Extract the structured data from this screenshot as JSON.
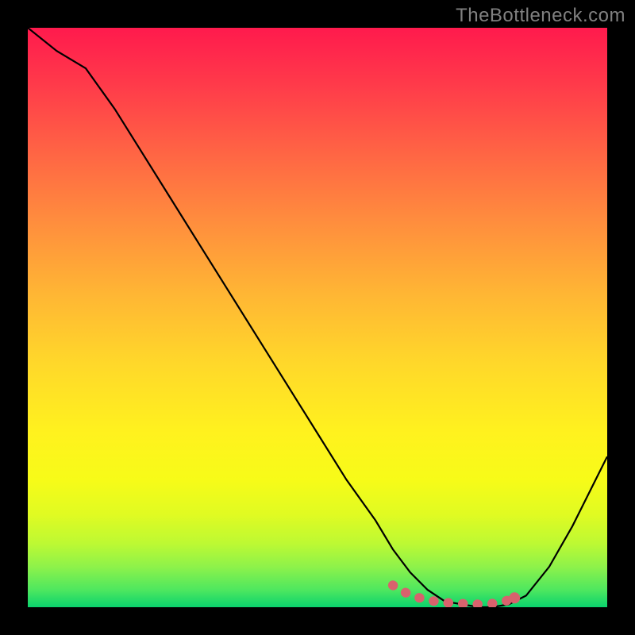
{
  "watermark": "TheBottleneck.com",
  "chart_data": {
    "type": "line",
    "title": "",
    "xlabel": "",
    "ylabel": "",
    "xlim": [
      0,
      100
    ],
    "ylim": [
      0,
      100
    ],
    "series": [
      {
        "name": "bottleneck-curve",
        "x": [
          0,
          5,
          10,
          15,
          20,
          25,
          30,
          35,
          40,
          45,
          50,
          55,
          60,
          63,
          66,
          69,
          72,
          75,
          78,
          80,
          83,
          86,
          90,
          94,
          98,
          100
        ],
        "values": [
          100,
          96,
          93,
          86,
          78,
          70,
          62,
          54,
          46,
          38,
          30,
          22,
          15,
          10,
          6,
          3,
          1,
          0.5,
          0,
          0,
          0.5,
          2,
          7,
          14,
          22,
          26
        ]
      }
    ],
    "highlight_dots": {
      "name": "sweet-spot",
      "x": [
        63,
        65,
        67,
        69,
        72,
        75,
        78,
        80,
        82,
        84
      ],
      "y": [
        3.8,
        2.6,
        1.8,
        1.2,
        0.8,
        0.6,
        0.5,
        0.6,
        0.9,
        1.6
      ]
    },
    "colors": {
      "curve": "#000000",
      "dots": "#d8626d",
      "gradient_top": "#ff1a4d",
      "gradient_bottom": "#0ad36d"
    }
  }
}
